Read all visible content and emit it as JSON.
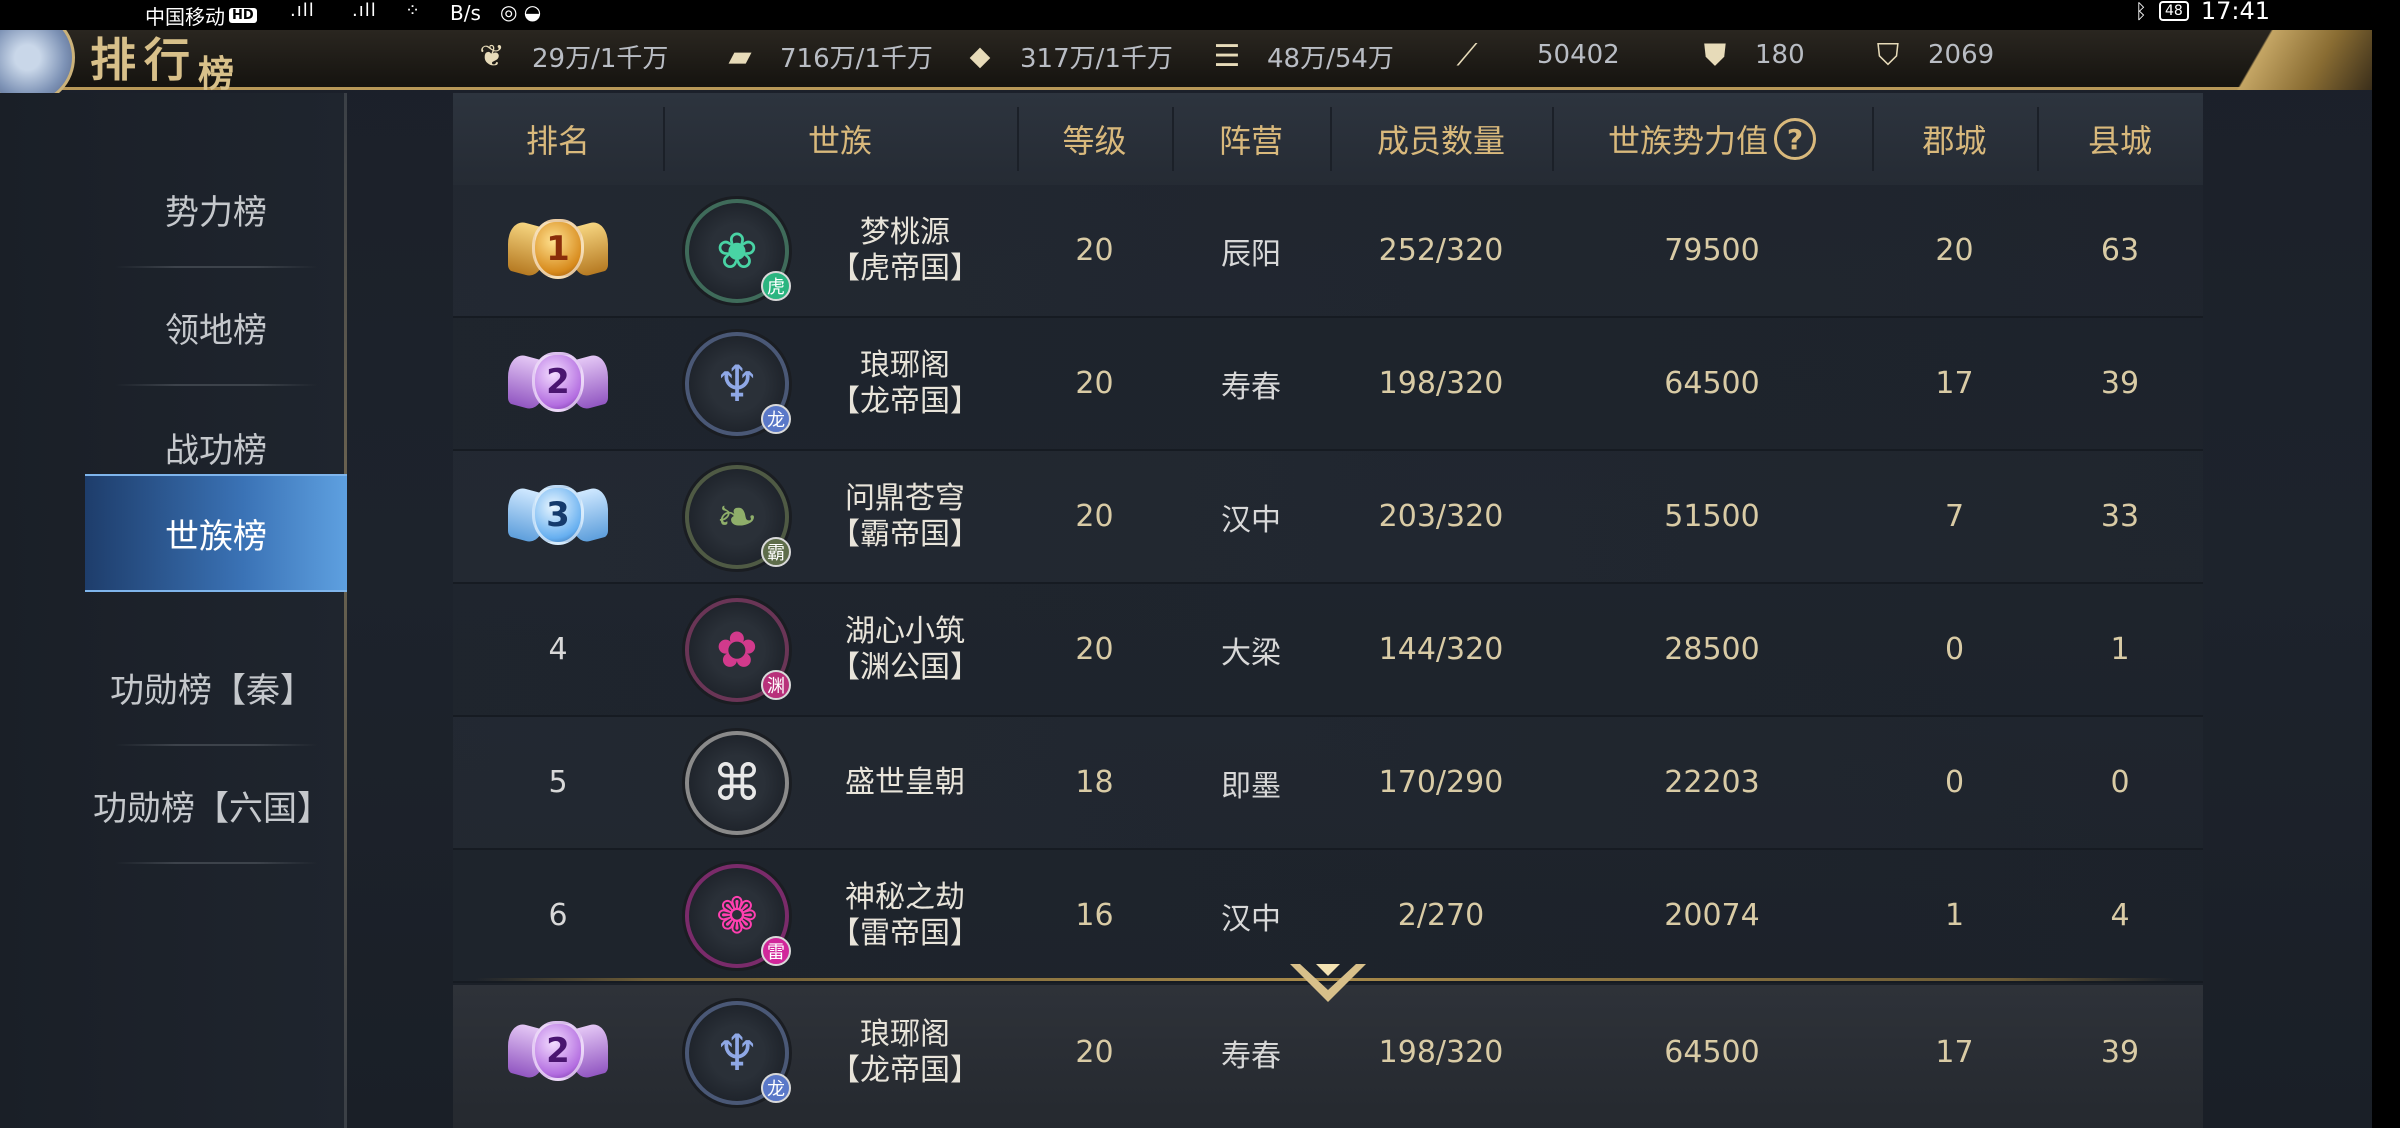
{
  "status_bar": {
    "carrier": "中国移动",
    "hd": "HD",
    "speed": "B/s",
    "time": "17:41"
  },
  "header": {
    "title_main": "排行",
    "title_small": "榜",
    "resources": [
      {
        "icon": "wheat-icon",
        "value": "29万/1千万"
      },
      {
        "icon": "wood-icon",
        "value": "716万/1千万"
      },
      {
        "icon": "stone-icon",
        "value": "317万/1千万"
      },
      {
        "icon": "iron-icon",
        "value": "48万/54万"
      },
      {
        "icon": "decree-icon",
        "value": "50402"
      },
      {
        "icon": "gold-ingot-icon",
        "value": "180"
      },
      {
        "icon": "silver-ingot-icon",
        "value": "2069"
      }
    ]
  },
  "sidebar": {
    "items": [
      {
        "label": "势力榜",
        "active": false
      },
      {
        "label": "领地榜",
        "active": false
      },
      {
        "label": "战功榜",
        "active": false
      },
      {
        "label": "世族榜",
        "active": true
      },
      {
        "label": "功勋榜【秦】",
        "active": false
      },
      {
        "label": "功勋榜【六国】",
        "active": false
      }
    ]
  },
  "table": {
    "headers": {
      "rank": "排名",
      "clan": "世族",
      "level": "等级",
      "camp": "阵营",
      "members": "成员数量",
      "power": "世族势力值",
      "help": "?",
      "jun": "郡城",
      "xian": "县城"
    },
    "rows": [
      {
        "rank": "1",
        "name": "梦桃源",
        "empire": "【虎帝国】",
        "level": "20",
        "camp": "辰阳",
        "members": "252/320",
        "power": "79500",
        "jun": "20",
        "xian": "63",
        "badge": "虎"
      },
      {
        "rank": "2",
        "name": "琅琊阁",
        "empire": "【龙帝国】",
        "level": "20",
        "camp": "寿春",
        "members": "198/320",
        "power": "64500",
        "jun": "17",
        "xian": "39",
        "badge": "龙"
      },
      {
        "rank": "3",
        "name": "问鼎苍穹",
        "empire": "【霸帝国】",
        "level": "20",
        "camp": "汉中",
        "members": "203/320",
        "power": "51500",
        "jun": "7",
        "xian": "33",
        "badge": "霸"
      },
      {
        "rank": "4",
        "name": "湖心小筑",
        "empire": "【渊公国】",
        "level": "20",
        "camp": "大梁",
        "members": "144/320",
        "power": "28500",
        "jun": "0",
        "xian": "1",
        "badge": "渊"
      },
      {
        "rank": "5",
        "name": "盛世皇朝",
        "empire": "",
        "level": "18",
        "camp": "即墨",
        "members": "170/290",
        "power": "22203",
        "jun": "0",
        "xian": "0",
        "badge": ""
      },
      {
        "rank": "6",
        "name": "神秘之劫",
        "empire": "【雷帝国】",
        "level": "16",
        "camp": "汉中",
        "members": "2/270",
        "power": "20074",
        "jun": "1",
        "xian": "4",
        "badge": "雷"
      }
    ],
    "my_clan": {
      "rank": "2",
      "name": "琅琊阁",
      "empire": "【龙帝国】",
      "level": "20",
      "camp": "寿春",
      "members": "198/320",
      "power": "64500",
      "jun": "17",
      "xian": "39",
      "badge": "龙"
    }
  },
  "colors": {
    "header_gold": "#d9b97c",
    "active_tab": "#3a72b5",
    "text": "#e6e2d8"
  }
}
